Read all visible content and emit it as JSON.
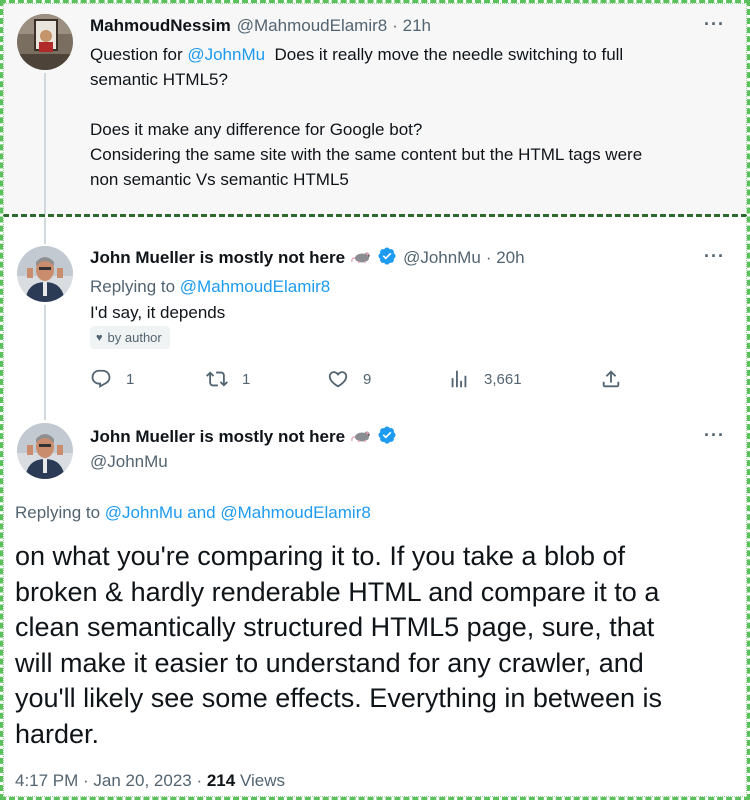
{
  "tweet1": {
    "name": "MahmoudNessim",
    "handle": "@MahmoudElamir8",
    "time": "· 21h",
    "line1_prefix": "Question for ",
    "line1_mention": "@JohnMu",
    "line1_suffix": "  Does it really move the needle switching to full",
    "line2": "semantic HTML5?",
    "line3": "Does it make any difference for Google bot?",
    "line4": "Considering the same site with the same content but the HTML tags were",
    "line5": "non semantic Vs semantic HTML5",
    "more": "···"
  },
  "tweet2": {
    "name": "John Mueller is mostly not here",
    "handle": "@JohnMu",
    "time": "· 20h",
    "replying_prefix": "Replying to ",
    "replying_mention": "@MahmoudElamir8",
    "text": "I'd say, it depends",
    "badge": "by author",
    "replies": "1",
    "retweets": "1",
    "likes": "9",
    "views": "3,661",
    "more": "···"
  },
  "tweet3": {
    "name": "John Mueller is mostly not here",
    "handle": "@JohnMu",
    "replying_prefix": "Replying to ",
    "replying_mentions": "@JohnMu and @MahmoudElamir8",
    "lines": [
      "on what you're comparing it to. If you take a blob of",
      "broken & hardly renderable HTML and compare it to a",
      "clean semantically structured HTML5 page, sure, that",
      "will make it easier to understand for any crawler, and",
      "you'll likely see some effects. Everything in between is",
      "harder."
    ],
    "date": "4:17 PM · Jan 20, 2023 · ",
    "views_count": "214",
    "views_label": " Views",
    "more": "···"
  },
  "colors": {
    "accent": "#1d9bf0",
    "secondary_text": "#536471",
    "verified": "#1d9bf0",
    "frame": "#5cc05c"
  },
  "icons": [
    "verified-icon",
    "rat-emoji-icon",
    "reply-icon",
    "retweet-icon",
    "like-icon",
    "views-icon",
    "share-icon",
    "heart-icon",
    "more-icon"
  ]
}
